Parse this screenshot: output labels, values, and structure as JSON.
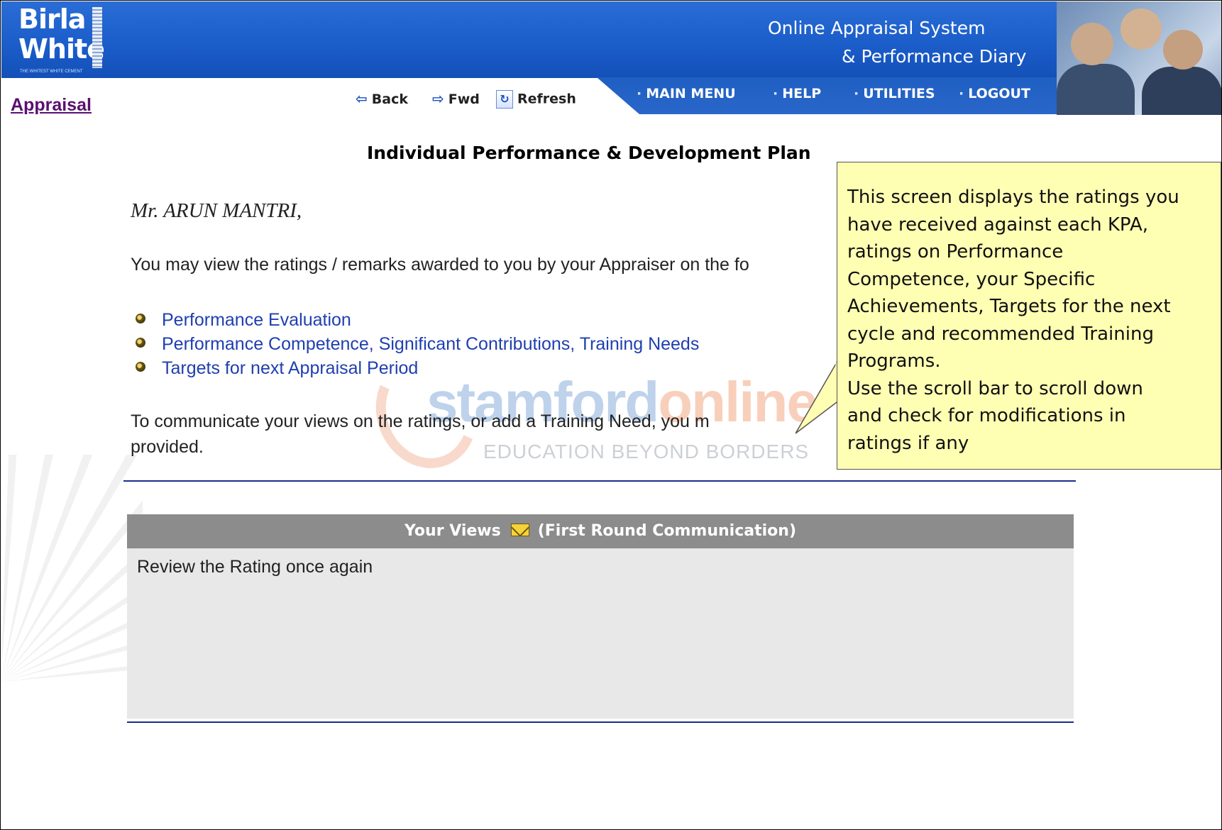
{
  "header": {
    "logo_line1": "Birla",
    "logo_line2": "White",
    "logo_tagline": "THE WHITEST WHITE CEMENT",
    "system_title_line1": "Online Appraisal System",
    "system_title_line2": "& Performance Diary"
  },
  "nav": {
    "items": [
      {
        "label": "MAIN MENU"
      },
      {
        "label": "HELP"
      },
      {
        "label": "UTILITIES"
      },
      {
        "label": "LOGOUT"
      }
    ]
  },
  "toolbar": {
    "back_label": "Back",
    "fwd_label": "Fwd",
    "refresh_label": "Refresh"
  },
  "sidebar": {
    "appraisal_link": "Appraisal"
  },
  "main": {
    "title": "Individual Performance & Development Plan",
    "greeting": "Mr. ARUN MANTRI,",
    "intro": "You may view the ratings / remarks awarded to you by your Appraiser on the fo",
    "links": [
      {
        "label": "Performance Evaluation"
      },
      {
        "label": "Performance Competence, Significant Contributions, Training Needs"
      },
      {
        "label": "Targets for next Appraisal Period"
      }
    ],
    "communicate_line1": "To communicate your views on the ratings, or add a Training Need, you m",
    "communicate_line2": "provided."
  },
  "views": {
    "header_label": "Your Views",
    "header_round": "(First Round Communication)",
    "body_text": "Review the Rating once again"
  },
  "watermark": {
    "brand_part1": "stamford",
    "brand_part2": "online",
    "tagline": "EDUCATION BEYOND BORDERS"
  },
  "callout": {
    "lines": [
      "This screen displays the ratings you",
      "have received against each KPA,",
      "ratings on Performance",
      "Competence, your Specific",
      "Achievements, Targets for the next",
      "cycle and recommended Training",
      "Programs.",
      "Use the scroll bar to scroll down",
      "and check for modifications in",
      "ratings if any"
    ]
  },
  "colors": {
    "header_blue": "#1a5cc8",
    "link_purple": "#5a0f72",
    "link_blue": "#1f3fb0",
    "callout_yellow": "#ffffb3",
    "views_header_gray": "#8c8c8c",
    "views_body_gray": "#e8e8e8"
  }
}
